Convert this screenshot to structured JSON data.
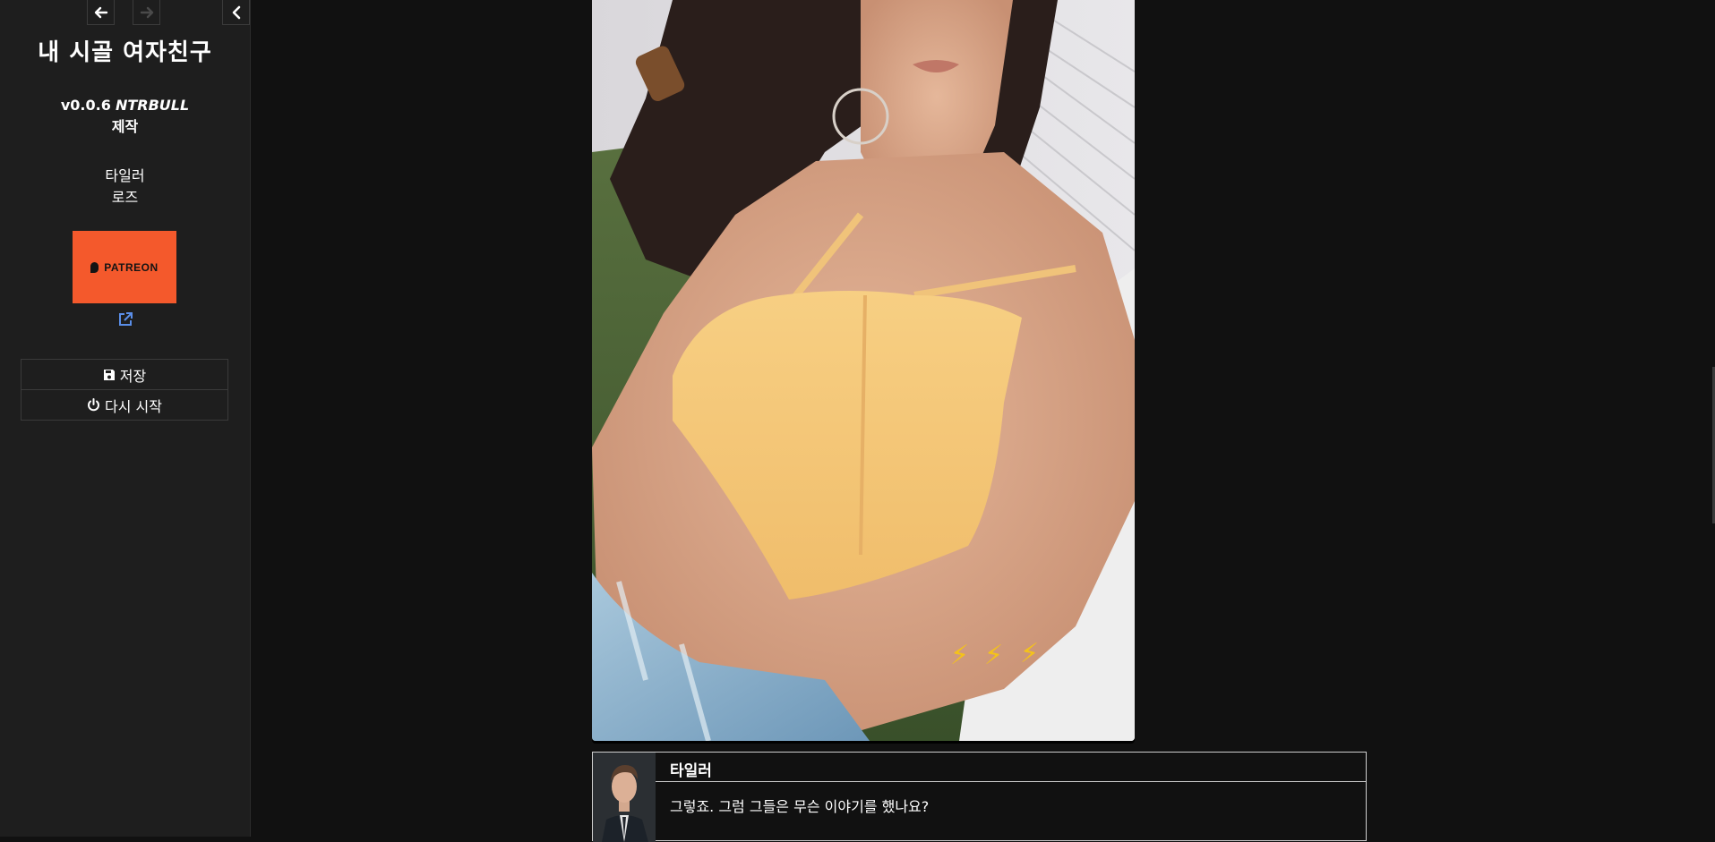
{
  "sidebar": {
    "back_icon": "arrow-left-icon",
    "forward_icon": "arrow-right-icon",
    "collapse_icon": "chevron-left-icon",
    "title": "내 시골 여자친구",
    "version": "v0.0.6",
    "author": "NTRBULL",
    "made_by": "제작",
    "characters": [
      "타일러",
      "로즈"
    ],
    "patreon_label": "PATREON",
    "external_link_icon": "external-link-icon",
    "save_label": "저장",
    "save_icon": "floppy-disk-icon",
    "restart_label": "다시 시작",
    "restart_icon": "power-icon"
  },
  "dialog": {
    "speaker": "타일러",
    "text": "그렇죠. 그럼 그들은 무슨 이야기를 했나요?"
  },
  "colors": {
    "background": "#111111",
    "sidebar_bg": "#1e1e1e",
    "patreon": "#f4592c",
    "link_blue": "#5a8ee8"
  }
}
